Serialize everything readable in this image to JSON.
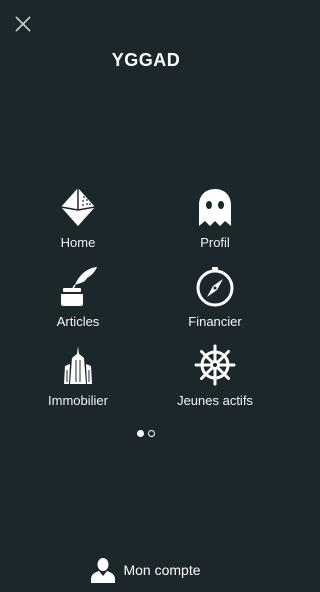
{
  "header": {
    "title": "YGGAD"
  },
  "menu": {
    "items": [
      {
        "label": "Home",
        "icon": "gem-icon"
      },
      {
        "label": "Profil",
        "icon": "ghost-icon"
      },
      {
        "label": "Articles",
        "icon": "quill-inkwell-icon"
      },
      {
        "label": "Financier",
        "icon": "compass-icon"
      },
      {
        "label": "Immobilier",
        "icon": "skyscraper-icon"
      },
      {
        "label": "Jeunes actifs",
        "icon": "ship-wheel-icon"
      }
    ]
  },
  "pager": {
    "pages": 2,
    "current": 1
  },
  "footer": {
    "account_label": "Mon compte",
    "icon": "user-icon"
  },
  "colors": {
    "background": "#1c272c",
    "foreground": "#ffffff"
  }
}
